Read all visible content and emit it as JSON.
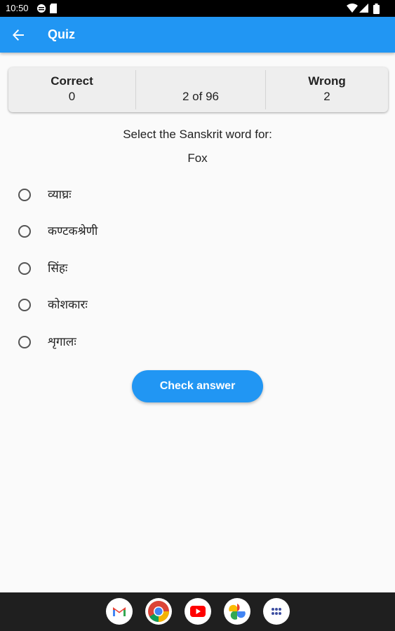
{
  "status": {
    "time": "10:50",
    "icons": [
      "settings-sync-icon",
      "sd-card-icon",
      "wifi-icon",
      "signal-icon",
      "battery-icon"
    ]
  },
  "appbar": {
    "title": "Quiz",
    "back_icon": "arrow-back-icon",
    "color": "#2196f3"
  },
  "score": {
    "correct_label": "Correct",
    "correct_value": "0",
    "progress": "2 of 96",
    "wrong_label": "Wrong",
    "wrong_value": "2"
  },
  "question": {
    "prompt": "Select the Sanskrit word for:",
    "word": "Fox"
  },
  "options": [
    {
      "label": "व्याघ्रः"
    },
    {
      "label": "कण्टकश्रेणी"
    },
    {
      "label": "सिंहः"
    },
    {
      "label": "कोशकारः"
    },
    {
      "label": "शृगालः"
    }
  ],
  "check_button": {
    "label": "Check answer"
  },
  "dock": {
    "apps": [
      "gmail-icon",
      "chrome-icon",
      "youtube-icon",
      "photos-icon",
      "app-drawer-icon"
    ]
  }
}
